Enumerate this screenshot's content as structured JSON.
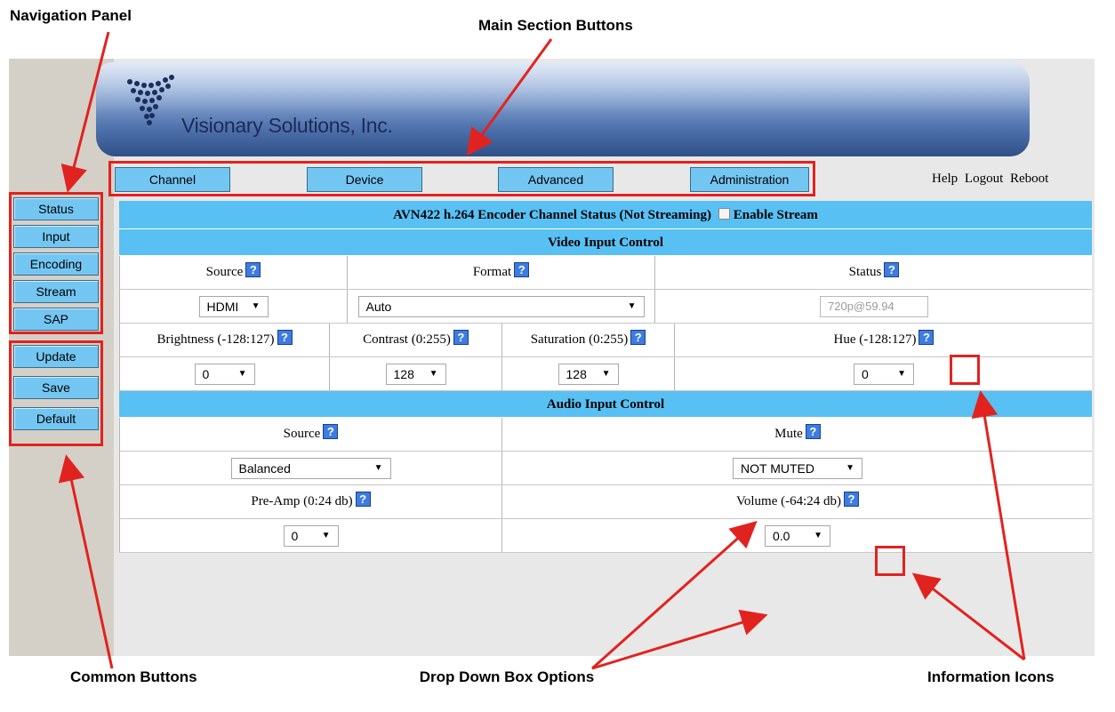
{
  "callouts": {
    "navigation_panel": "Navigation Panel",
    "main_section_buttons": "Main Section Buttons",
    "common_buttons": "Common Buttons",
    "drop_down_box_options": "Drop Down Box Options",
    "information_icons": "Information Icons"
  },
  "banner": {
    "brand": "Visionary Solutions, Inc."
  },
  "main_tabs": [
    "Channel",
    "Device",
    "Advanced",
    "Administration"
  ],
  "top_links": [
    "Help",
    "Logout",
    "Reboot"
  ],
  "nav": [
    "Status",
    "Input",
    "Encoding",
    "Stream",
    "SAP"
  ],
  "common": [
    "Update",
    "Save",
    "Default"
  ],
  "status_title": "AVN422 h.264 Encoder Channel Status (Not Streaming)",
  "enable_stream": "Enable Stream",
  "video": {
    "heading": "Video Input Control",
    "source_label": "Source",
    "format_label": "Format",
    "status_label": "Status",
    "source_value": "HDMI",
    "format_value": "Auto",
    "status_value": "720p@59.94",
    "brightness_label": "Brightness (-128:127)",
    "contrast_label": "Contrast (0:255)",
    "saturation_label": "Saturation (0:255)",
    "hue_label": "Hue (-128:127)",
    "brightness_value": "0",
    "contrast_value": "128",
    "saturation_value": "128",
    "hue_value": "0"
  },
  "audio": {
    "heading": "Audio Input Control",
    "source_label": "Source",
    "mute_label": "Mute",
    "source_value": "Balanced",
    "mute_value": "NOT MUTED",
    "preamp_label": "Pre-Amp (0:24 db)",
    "volume_label": "Volume (-64:24 db)",
    "preamp_value": "0",
    "volume_value": "0.0"
  },
  "icons": {
    "info": "question-icon",
    "dropdown": "chevron-down-icon",
    "logo": "vsi-logo-icon"
  },
  "colors": {
    "button": "#73c6f2",
    "band": "#59c0f3",
    "callout_red": "#e1231f",
    "info_icon": "#3d7ce0"
  }
}
